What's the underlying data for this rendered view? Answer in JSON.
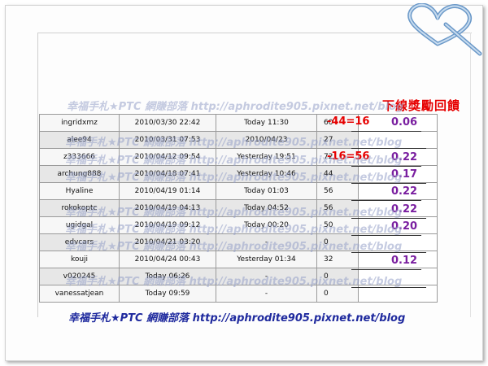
{
  "bonus_header": "下線獎勵回饋",
  "watermark_text": "幸福手札★PTC 網賺部落 http://aphrodite905.pixnet.net/blog",
  "footer_text": "幸福手札★PTC 網賺部落 http://aphrodite905.pixnet.net/blog",
  "rows": [
    {
      "name": "ingridxmz",
      "joined": "2010/03/30 22:42",
      "last": "Today 11:30",
      "clicks": "60",
      "eq": "-44=16",
      "bonus": "0.06",
      "style": "light"
    },
    {
      "name": "alee94",
      "joined": "2010/03/31 07:53",
      "last": "2010/04/23",
      "clicks": "27",
      "eq": "",
      "bonus": "",
      "style": "shade"
    },
    {
      "name": "z333666",
      "joined": "2010/04/12 09:54",
      "last": "Yesterday 19:51",
      "clicks": "72",
      "eq": "-16=56",
      "bonus": "0.22",
      "style": "light"
    },
    {
      "name": "archung888",
      "joined": "2010/04/18 07:41",
      "last": "Yesterday 10:46",
      "clicks": "44",
      "eq": "",
      "bonus": "0.17",
      "style": "shade"
    },
    {
      "name": "Hyaline",
      "joined": "2010/04/19 01:14",
      "last": "Today 01:03",
      "clicks": "56",
      "eq": "",
      "bonus": "0.22",
      "style": "light"
    },
    {
      "name": "rokokoptc",
      "joined": "2010/04/19 04:13",
      "last": "Today 04:52",
      "clicks": "56",
      "eq": "",
      "bonus": "0.22",
      "style": "shade"
    },
    {
      "name": "ugidgal",
      "joined": "2010/04/19 09:12",
      "last": "Today 00:20",
      "clicks": "50",
      "eq": "",
      "bonus": "0.20",
      "style": "light"
    },
    {
      "name": "edvcars",
      "joined": "2010/04/21 03:20",
      "last": "-",
      "clicks": "0",
      "eq": "",
      "bonus": "",
      "style": "shade"
    },
    {
      "name": "kouji",
      "joined": "2010/04/24 00:43",
      "last": "Yesterday 01:34",
      "clicks": "32",
      "eq": "",
      "bonus": "0.12",
      "style": "light"
    },
    {
      "name": "v020245",
      "joined": "Today 06:26",
      "last": "-",
      "clicks": "0",
      "eq": "",
      "bonus": "",
      "style": "shade"
    },
    {
      "name": "vanessatjean",
      "joined": "Today 09:59",
      "last": "-",
      "clicks": "0",
      "eq": "",
      "bonus": "",
      "style": "light"
    }
  ],
  "colors": {
    "bonus_header": "#e60000",
    "equation": "#e60000",
    "bonus_value": "#7a1fa0",
    "footer": "#1f2a9e",
    "heart": "#6a98c8"
  }
}
